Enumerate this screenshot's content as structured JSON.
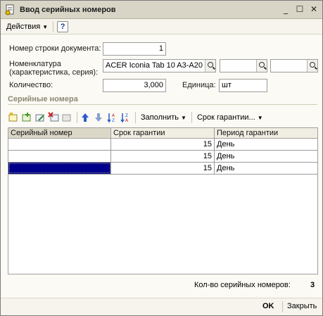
{
  "window": {
    "title": "Ввод серийных номеров"
  },
  "toolbar": {
    "actions_label": "Действия",
    "help_label": "?"
  },
  "form": {
    "line_number_label": "Номер строки документа:",
    "line_number_value": "1",
    "nomenclature_label_1": "Номенклатура",
    "nomenclature_label_2": "(характеристика, серия):",
    "nomenclature_value": "ACER Iconia Tab 10 A3-A20",
    "characteristic_value": "",
    "series_value": "",
    "quantity_label": "Количество:",
    "quantity_value": "3,000",
    "unit_label": "Единица:",
    "unit_value": "шт"
  },
  "section": {
    "title": "Серийные номера"
  },
  "table_toolbar": {
    "fill_label": "Заполнить",
    "warranty_label": "Срок гарантии..."
  },
  "table": {
    "columns": [
      "Серийный номер",
      "Срок гарантии",
      "Период гарантии"
    ],
    "rows": [
      {
        "serial": "",
        "term": "15",
        "period": "День"
      },
      {
        "serial": "",
        "term": "15",
        "period": "День"
      },
      {
        "serial": "",
        "term": "15",
        "period": "День"
      }
    ]
  },
  "summary": {
    "count_label": "Кол-во серийных номеров:",
    "count_value": "3"
  },
  "footer": {
    "ok_label": "OK",
    "close_label": "Закрыть"
  },
  "colors": {
    "selection": "#00008b",
    "section_title": "#8d8874",
    "titlebar": "#d9d5c6"
  },
  "icons": [
    "document-icon",
    "add-row-icon",
    "copy-row-icon",
    "edit-row-icon",
    "delete-row-icon",
    "end-edit-icon",
    "move-up-icon",
    "move-down-icon",
    "sort-asc-icon",
    "sort-desc-icon",
    "search-icon"
  ]
}
